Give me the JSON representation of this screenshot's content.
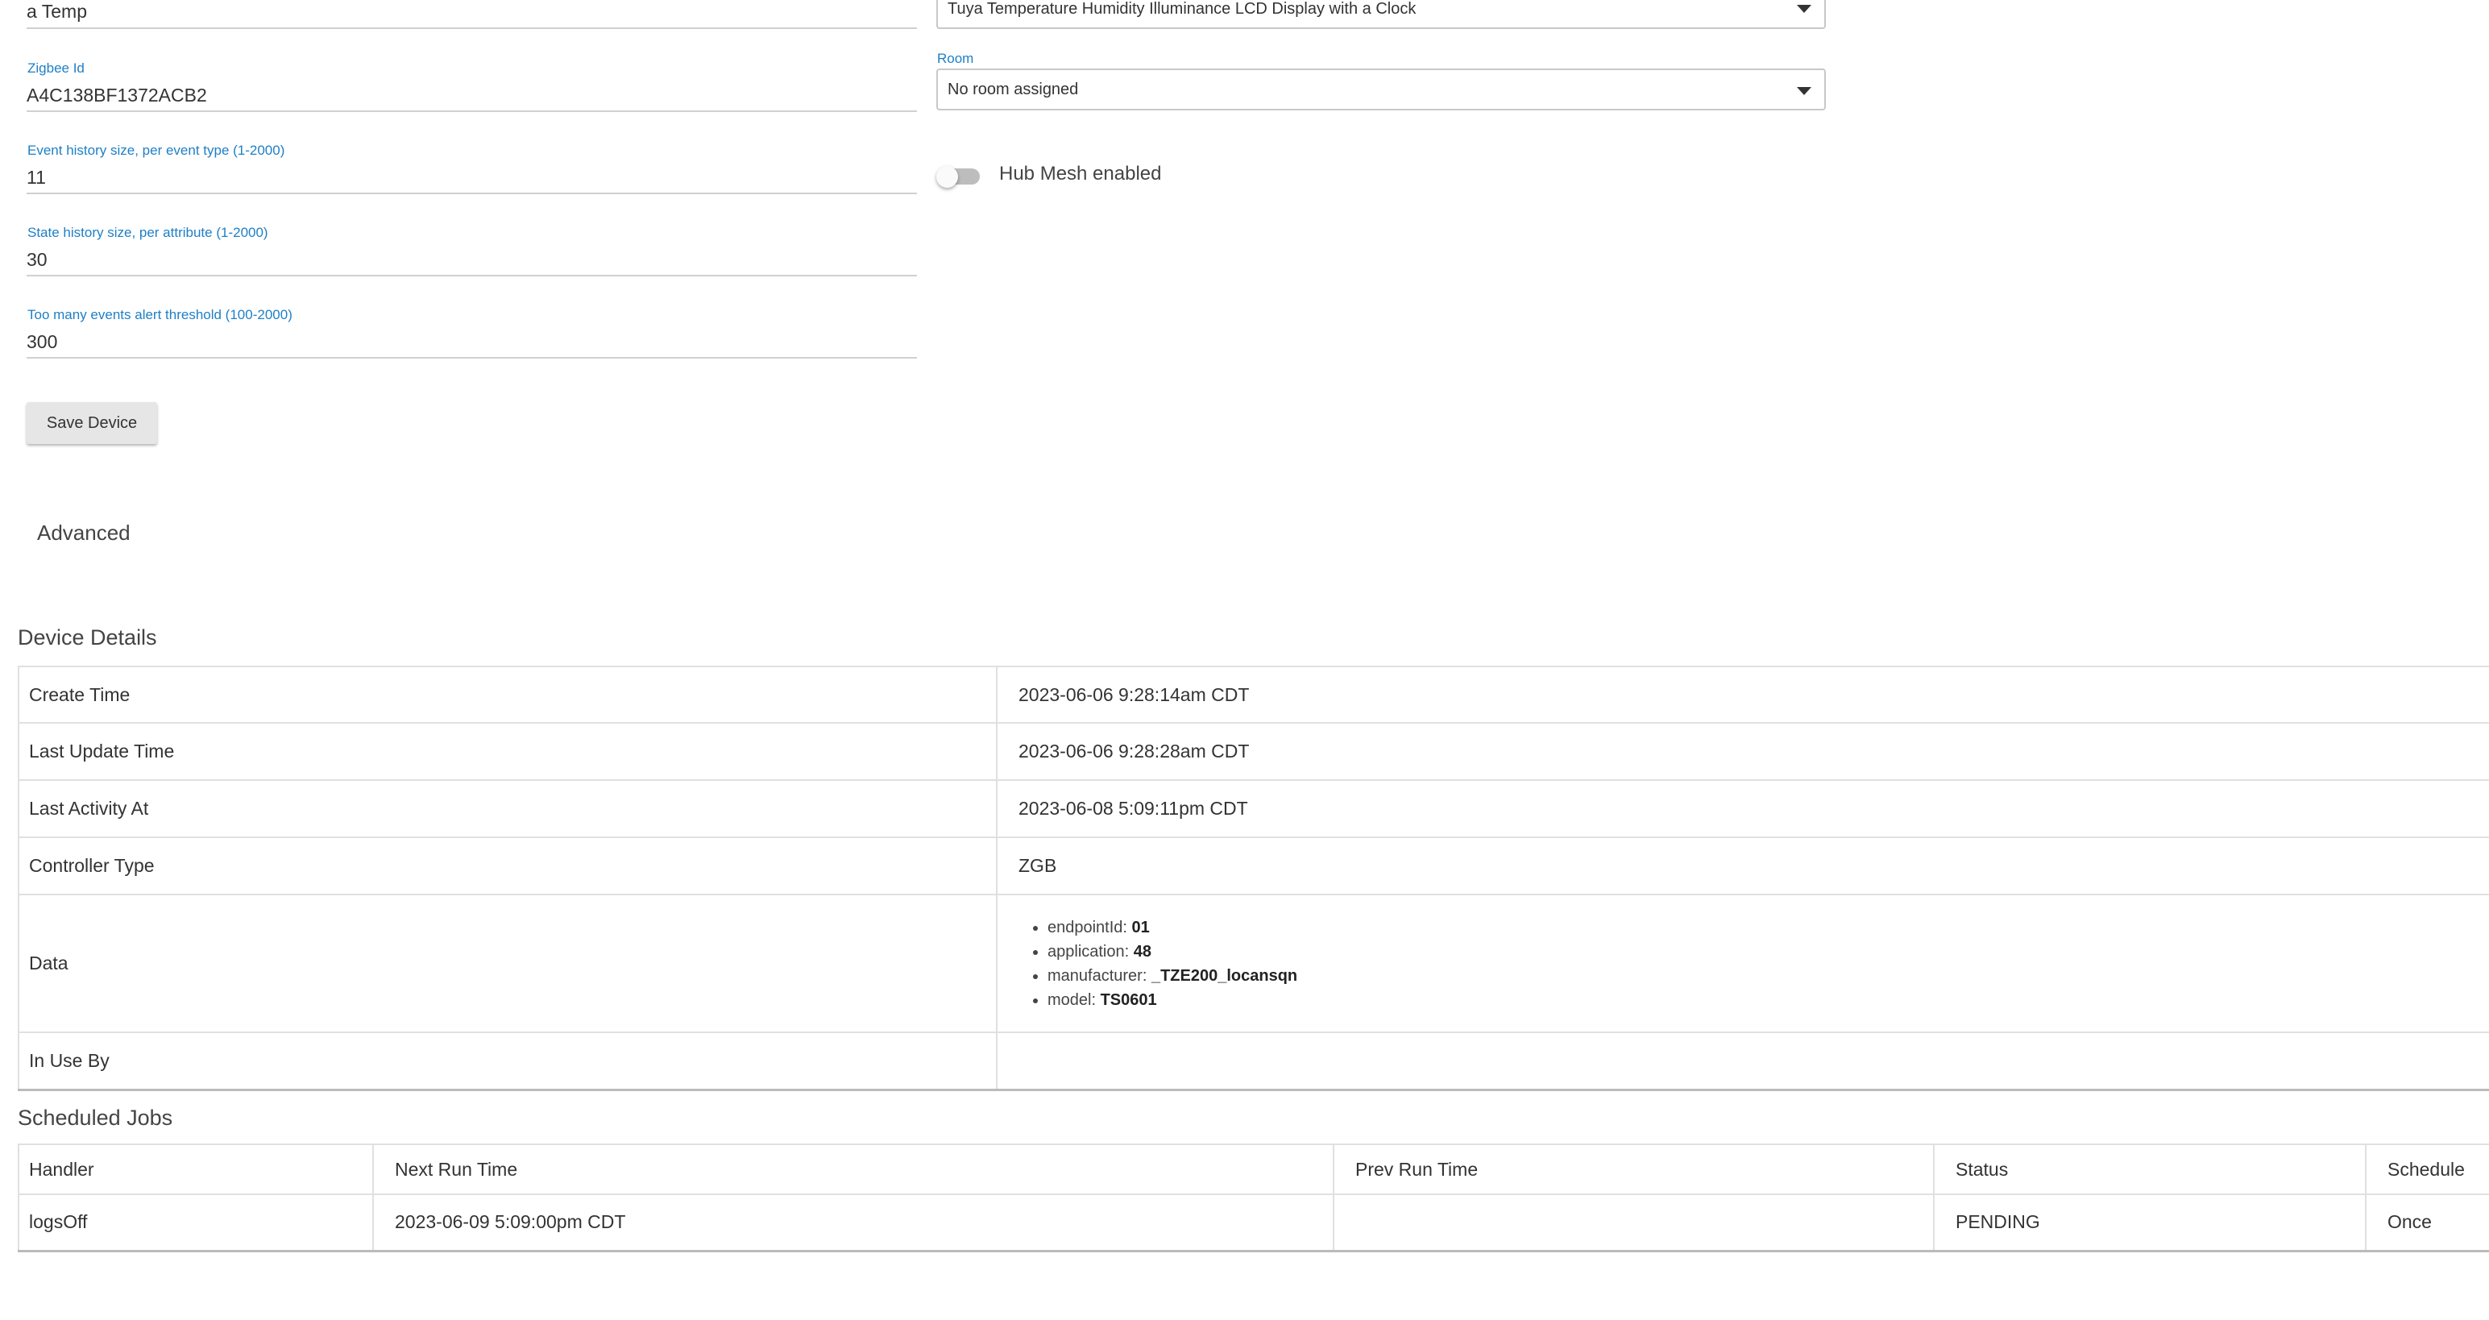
{
  "form": {
    "name_value": "a Temp",
    "zigbee_label": "Zigbee Id",
    "zigbee_value": "A4C138BF1372ACB2",
    "event_history_label": "Event history size, per event type (1-2000)",
    "event_history_value": "11",
    "state_history_label": "State history size, per attribute (1-2000)",
    "state_history_value": "30",
    "too_many_events_label": "Too many events alert threshold (100-2000)",
    "too_many_events_value": "300",
    "type_value": "Tuya Temperature Humidity Illuminance LCD Display with a Clock",
    "room_label": "Room",
    "room_value": "No room assigned",
    "hub_mesh_label": "Hub Mesh enabled",
    "hub_mesh_enabled": false,
    "save_label": "Save Device",
    "advanced_label": "Advanced"
  },
  "device_details": {
    "title": "Device Details",
    "rows": [
      {
        "label": "Create Time",
        "value": "2023-06-06 9:28:14am CDT"
      },
      {
        "label": "Last Update Time",
        "value": "2023-06-06 9:28:28am CDT"
      },
      {
        "label": "Last Activity At",
        "value": "2023-06-08 5:09:11pm CDT"
      },
      {
        "label": "Controller Type",
        "value": "ZGB"
      }
    ],
    "data_label": "Data",
    "data_items": [
      {
        "key": "endpointId:",
        "value": "01"
      },
      {
        "key": "application:",
        "value": "48"
      },
      {
        "key": "manufacturer:",
        "value": "_TZE200_locansqn"
      },
      {
        "key": "model:",
        "value": "TS0601"
      }
    ],
    "in_use_label": "In Use By",
    "in_use_value": ""
  },
  "scheduled_jobs": {
    "title": "Scheduled Jobs",
    "headers": {
      "handler": "Handler",
      "next_run": "Next Run Time",
      "prev_run": "Prev Run Time",
      "status": "Status",
      "schedule": "Schedule"
    },
    "rows": [
      {
        "handler": "logsOff",
        "next_run": "2023-06-09 5:09:00pm CDT",
        "prev_run": "",
        "status": "PENDING",
        "schedule": "Once"
      }
    ]
  }
}
